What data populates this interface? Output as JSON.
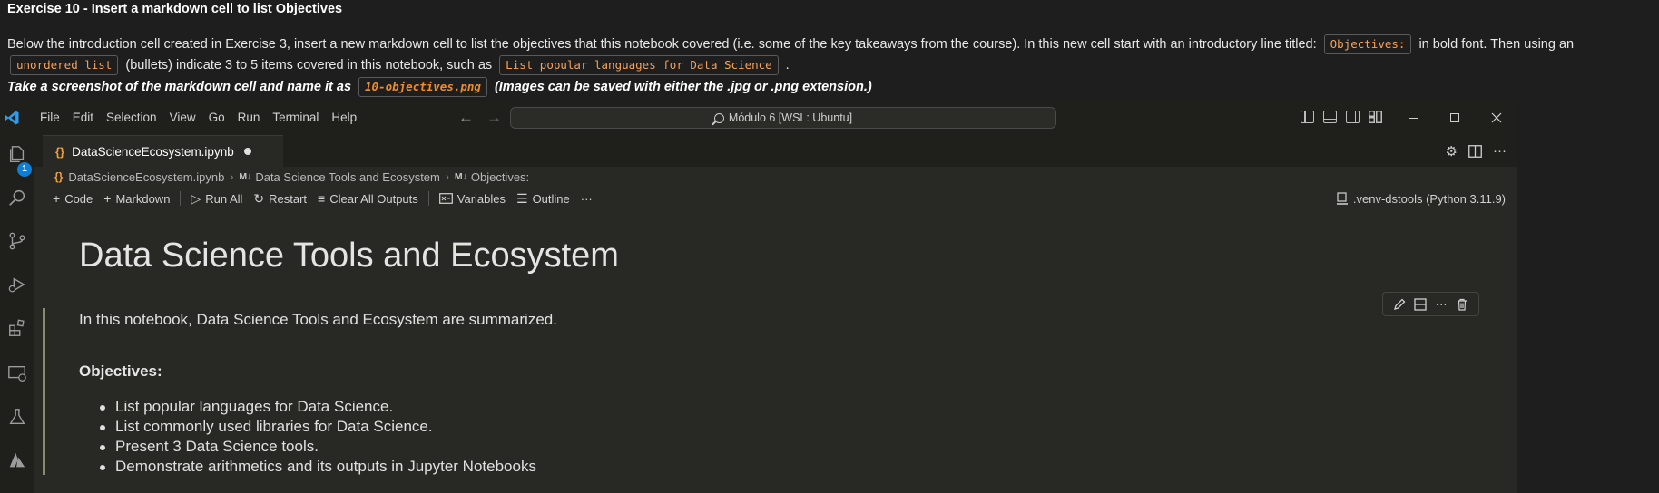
{
  "instructions": {
    "title": "Exercise 10 - Insert a markdown cell to list Objectives",
    "line1_a": "Below the introduction cell created in Exercise 3, insert a new markdown cell to list the objectives that this notebook covered (i.e. some of the key takeaways from the course). In this new cell start with an introductory line titled:",
    "chip_objectives": "Objectives:",
    "line1_b": "in bold font. Then using an",
    "chip_unordered": "unordered list",
    "line2_a": "(bullets) indicate 3 to 5 items covered in this notebook, such as",
    "chip_example": "List popular languages for Data Science",
    "line2_b": ".",
    "line3_a": "Take a screenshot of the markdown cell and name it as",
    "chip_filename": "10-objectives.png",
    "line3_b": "(Images can be saved with either the .jpg or .png extension.)"
  },
  "titlebar": {
    "menu": [
      "File",
      "Edit",
      "Selection",
      "View",
      "Go",
      "Run",
      "Terminal",
      "Help"
    ],
    "search_text": "Módulo 6 [WSL: Ubuntu]"
  },
  "activity": {
    "explorer_badge": "1"
  },
  "tab": {
    "label": "DataScienceEcosystem.ipynb",
    "icon": "{}"
  },
  "breadcrumb": {
    "file": "DataScienceEcosystem.ipynb",
    "md_marker": "M↓",
    "section": "Data Science Tools and Ecosystem",
    "subsection": "Objectives:"
  },
  "toolbar": {
    "code": "Code",
    "markdown": "Markdown",
    "run_all": "Run All",
    "restart": "Restart",
    "clear_outputs": "Clear All Outputs",
    "variables": "Variables",
    "outline": "Outline",
    "more": "···",
    "kernel": ".venv-dstools (Python 3.11.9)"
  },
  "notebook": {
    "title": "Data Science Tools and Ecosystem",
    "intro": "In this notebook, Data Science Tools and Ecosystem are summarized.",
    "objectives_title": "Objectives:",
    "objectives": [
      "List popular languages for Data Science.",
      "List commonly used libraries for Data Science.",
      "Present 3 Data Science tools.",
      "Demonstrate arithmetics and its outputs in Jupyter Notebooks"
    ]
  },
  "colors": {
    "accent": "#0f7fd6",
    "chip_text": "#f4a15d",
    "editor_bg": "#282824"
  }
}
